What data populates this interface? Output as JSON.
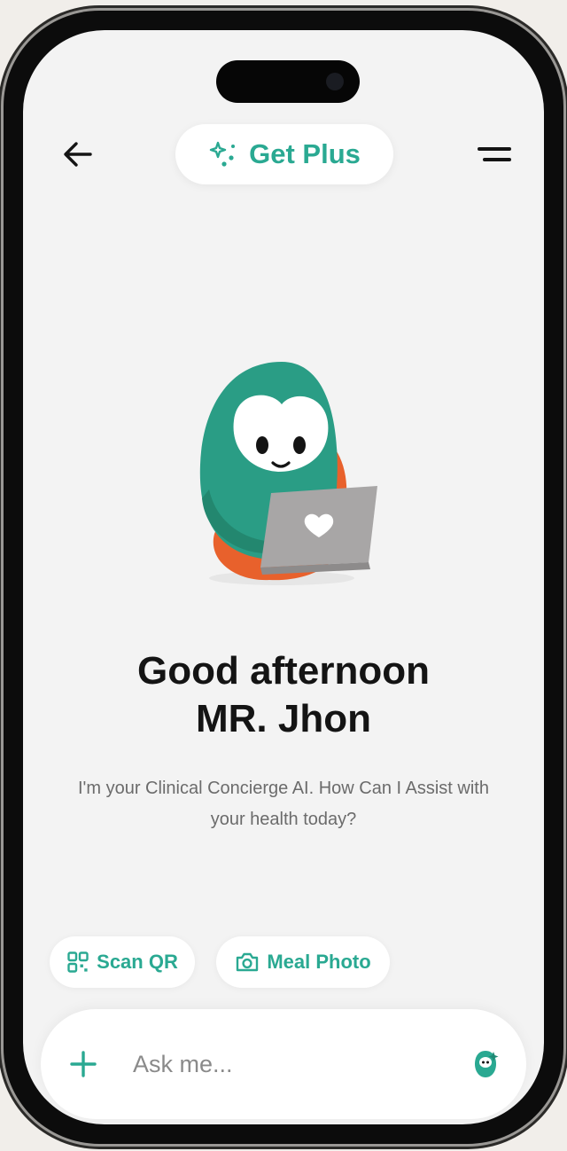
{
  "header": {
    "back_icon": "arrow-left-icon",
    "upgrade_label": "Get Plus",
    "upgrade_icon": "sparkle-icon",
    "menu_icon": "menu-icon"
  },
  "hero": {
    "illustration": "owl-mascot-with-laptop",
    "greeting_line1": "Good afternoon",
    "greeting_line2": "MR. Jhon",
    "subtitle": "I'm your Clinical Concierge AI. How Can I Assist with your health today?"
  },
  "quick_actions": [
    {
      "label": "Scan QR",
      "icon": "qr-icon"
    },
    {
      "label": "Meal Photo",
      "icon": "camera-icon"
    }
  ],
  "composer": {
    "add_icon": "plus-icon",
    "placeholder": "Ask me...",
    "value": "",
    "voice_icon": "voice-assistant-icon"
  },
  "colors": {
    "accent": "#2aa992",
    "mascot_body": "#2a9d85",
    "mascot_orange": "#e8612c",
    "background": "#f3f3f3",
    "text_primary": "#141414",
    "text_secondary": "#6b6b6b"
  }
}
